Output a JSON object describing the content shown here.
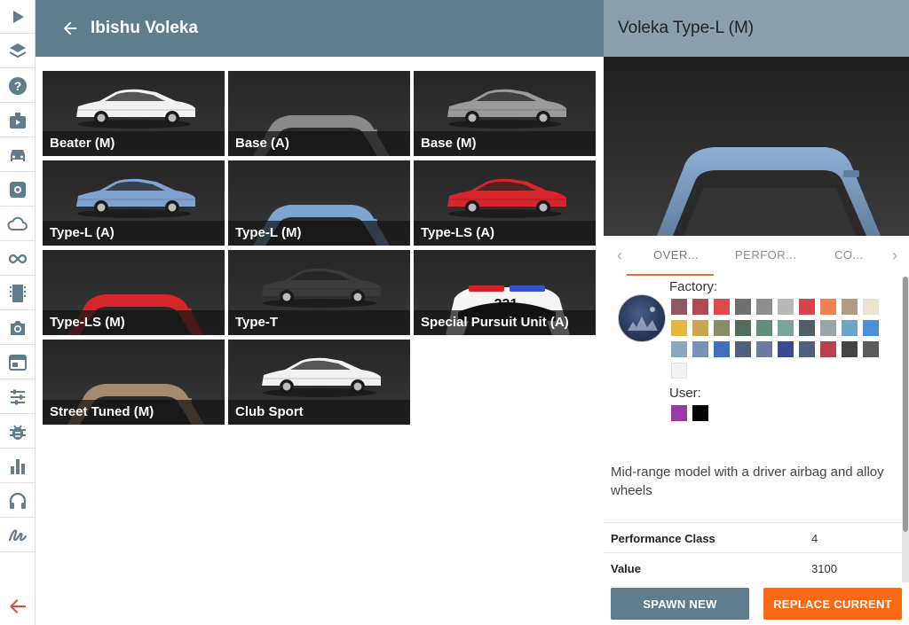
{
  "header": {
    "title": "Ibishu Voleka",
    "back_icon": "arrow-left-icon"
  },
  "rail": {
    "icons": [
      "play-icon",
      "layers-icon",
      "help-icon",
      "vehicle-config-icon",
      "car-icon",
      "part-config-icon",
      "cloud-icon",
      "infinity-icon",
      "film-icon",
      "camera-icon",
      "environment-icon",
      "sliders-icon",
      "bug-icon",
      "bar-chart-icon",
      "headphones-icon",
      "signature-icon"
    ],
    "back_icon": "exit-arrow-icon"
  },
  "configs": [
    {
      "label": "Beater (M)",
      "car_color": "#f2f2f2",
      "view": "side"
    },
    {
      "label": "Base (A)",
      "car_color": "#8a8a8a",
      "view": "front"
    },
    {
      "label": "Base (M)",
      "car_color": "#9a9a9a",
      "view": "side"
    },
    {
      "label": "Type-L (A)",
      "car_color": "#7ea4d2",
      "view": "side"
    },
    {
      "label": "Type-L (M)",
      "car_color": "#7ea4d2",
      "view": "front"
    },
    {
      "label": "Type-LS (A)",
      "car_color": "#d6252b",
      "view": "side"
    },
    {
      "label": "Type-LS (M)",
      "car_color": "#d6252b",
      "view": "front"
    },
    {
      "label": "Type-T",
      "car_color": "#3a3a3a",
      "view": "side"
    },
    {
      "label": "Special Pursuit Unit (A)",
      "car_color": "#f5f5f5",
      "view": "police",
      "badge": "331"
    },
    {
      "label": "Street Tuned (M)",
      "car_color": "#a48a6e",
      "view": "front"
    },
    {
      "label": "Club Sport",
      "car_color": "#f2f2f2",
      "view": "side"
    }
  ],
  "detail": {
    "title": "Voleka Type-L (M)",
    "tabs": [
      {
        "label": "OVER...",
        "active": true
      },
      {
        "label": "PERFOR...",
        "active": false
      },
      {
        "label": "CO...",
        "active": false
      }
    ],
    "factory_label": "Factory:",
    "user_label": "User:",
    "factory_colors": [
      "#8c5a5e",
      "#b04a55",
      "#e0484e",
      "#6f6f6f",
      "#8e8e8e",
      "#b9b9b9",
      "#d9434a",
      "#f08250",
      "#b39a86",
      "#f1e2cf",
      "#e3b83e",
      "#c9a64d",
      "#8a8a6d",
      "#4f6f58",
      "#5f8f7a",
      "#7aa39c",
      "#4f5f66",
      "#9aa5aa",
      "#6aa6c8",
      "#4a90d8",
      "#8aa6c0",
      "#7792b8",
      "#3f6fc0",
      "#4f5f80",
      "#6a7aa0",
      "#3a4a90",
      "#4f5f7f",
      "#b9424a",
      "#444444",
      "#5a5a5a",
      "#f2f2f2"
    ],
    "user_colors": [
      "#9a3aa8",
      "#050505"
    ],
    "description": "Mid-range model with a driver airbag and alloy wheels",
    "stats": [
      {
        "key": "Performance Class",
        "value": "4"
      },
      {
        "key": "Value",
        "value": "3100"
      }
    ],
    "spawn_label": "SPAWN NEW",
    "replace_label": "REPLACE CURRENT"
  },
  "colors": {
    "header": "#5f7d8c",
    "detail_header": "#8aa0aa",
    "accent": "#fa6a14",
    "rail_icon": "#5f7d8c",
    "exit": "#e0463a"
  }
}
